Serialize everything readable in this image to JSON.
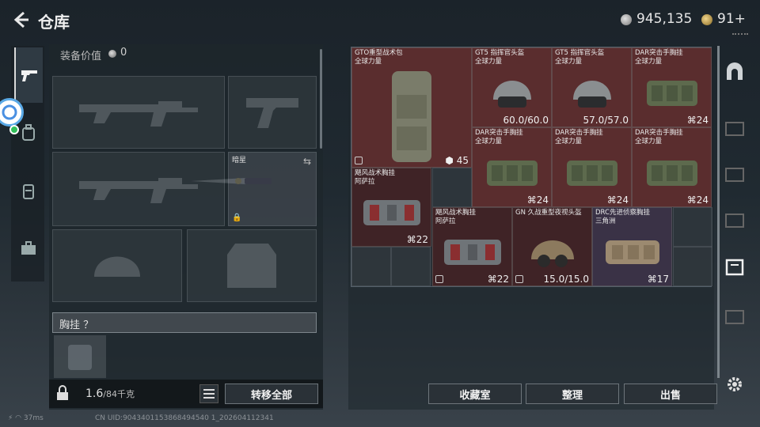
{
  "header": {
    "title": "仓库",
    "silver": "945,135",
    "gold": "91+"
  },
  "left": {
    "equip_label": "装备价值",
    "equip_value": "0",
    "melee_label": "暗星",
    "section_label": "胸挂 ？",
    "weight_value": "1.6",
    "weight_cap": "/84千克",
    "transfer_label": "转移全部"
  },
  "grid": {
    "items": [
      {
        "name": "GTO重型战术包",
        "sub": "全球力量",
        "qty": "45",
        "color": "red"
      },
      {
        "name": "GT5 指挥官头盔",
        "sub": "全球力量",
        "qty": "60.0/60.0",
        "color": "red"
      },
      {
        "name": "GT5 指挥官头盔",
        "sub": "全球力量",
        "qty": "57.0/57.0",
        "color": "red"
      },
      {
        "name": "DAR突击手胸挂",
        "sub": "全球力量",
        "qty": "24",
        "color": "red"
      },
      {
        "name": "DAR突击手胸挂",
        "sub": "全球力量",
        "qty": "24",
        "color": "red"
      },
      {
        "name": "DAR突击手胸挂",
        "sub": "全球力量",
        "qty": "24",
        "color": "red"
      },
      {
        "name": "DAR突击手胸挂",
        "sub": "全球力量",
        "qty": "24",
        "color": "red"
      },
      {
        "name": "飓风战术胸挂",
        "sub": "阿萨拉",
        "qty": "22",
        "color": "dred"
      },
      {
        "name": "飓风战术胸挂",
        "sub": "阿萨拉",
        "qty": "22",
        "color": "dred"
      },
      {
        "name": "GN 久战重型夜视头盔",
        "sub": "",
        "qty": "15.0/15.0",
        "color": "dred"
      },
      {
        "name": "DRC先进侦察胸挂",
        "sub": "三角洲",
        "qty": "17",
        "color": "purple"
      }
    ]
  },
  "actions": {
    "collection": "收藏室",
    "sort": "整理",
    "sell": "出售"
  },
  "status": {
    "ping": "37ms",
    "uid": "CN UID:9043401153868494540 1_202604112341"
  }
}
